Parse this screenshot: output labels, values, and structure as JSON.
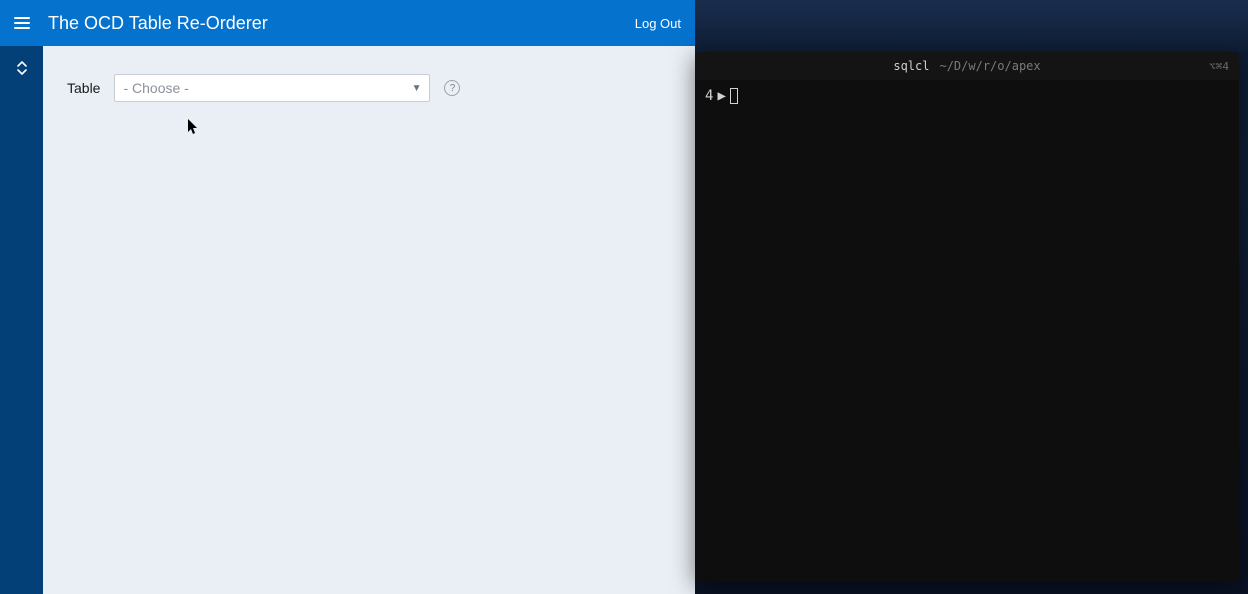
{
  "header": {
    "title": "The OCD Table Re-Orderer",
    "logout_label": "Log Out"
  },
  "form": {
    "table_label": "Table",
    "table_placeholder": "- Choose -"
  },
  "terminal": {
    "title_left": "sqlcl",
    "title_right": "~/D/w/r/o/apex",
    "shortcut": "⌥⌘4",
    "prompt_num": "4",
    "prompt_arrow": "▶"
  }
}
